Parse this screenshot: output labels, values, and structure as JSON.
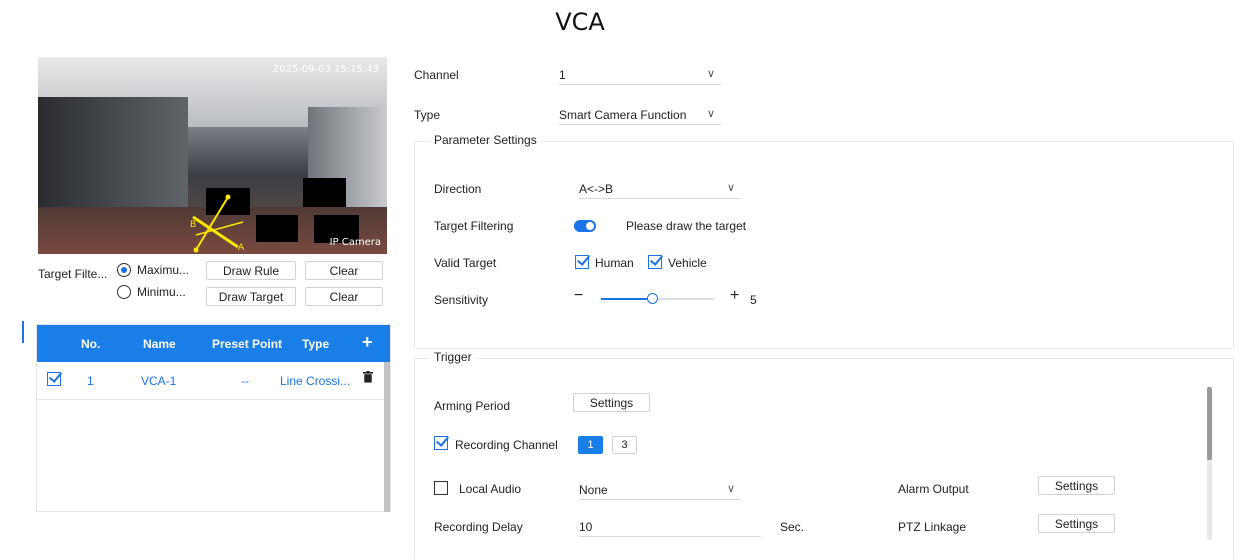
{
  "page_title": "VCA",
  "video": {
    "timestamp": "2025-09-03 15:15:43",
    "camera_name": "IP Camera"
  },
  "target_filter": {
    "label": "Target Filte...",
    "options": [
      {
        "label": "Maximu...",
        "selected": true
      },
      {
        "label": "Minimu...",
        "selected": false
      }
    ],
    "draw_rule_label": "Draw Rule",
    "draw_target_label": "Draw Target",
    "clear_label": "Clear"
  },
  "table": {
    "headers": [
      "No.",
      "Name",
      "Preset Point",
      "Type"
    ],
    "add_icon": "plus-icon",
    "rows": [
      {
        "checked": true,
        "no": "1",
        "name": "VCA-1",
        "preset": "--",
        "type": "Line Crossi..."
      }
    ]
  },
  "channel": {
    "label": "Channel",
    "value": "1"
  },
  "type": {
    "label": "Type",
    "value": "Smart Camera Function"
  },
  "parameter_settings": {
    "legend": "Parameter Settings",
    "direction_label": "Direction",
    "direction_value": "A<->B",
    "target_filtering_label": "Target Filtering",
    "target_filtering_on": true,
    "draw_hint": "Please draw the target",
    "valid_target_label": "Valid Target",
    "human_label": "Human",
    "vehicle_label": "Vehicle",
    "sensitivity_label": "Sensitivity",
    "sensitivity_value": "5",
    "sensitivity_fraction": 0.45,
    "minus": "−",
    "plus": "+"
  },
  "trigger": {
    "legend": "Trigger",
    "arming_period_label": "Arming Period",
    "settings_label": "Settings",
    "recording_channel_label": "Recording Channel",
    "recording_channels": [
      {
        "label": "1",
        "selected": true
      },
      {
        "label": "3",
        "selected": false
      }
    ],
    "local_audio_label": "Local Audio",
    "local_audio_value": "None",
    "alarm_output_label": "Alarm Output",
    "recording_delay_label": "Recording Delay",
    "recording_delay_value": "10",
    "recording_delay_unit": "Sec.",
    "ptz_linkage_label": "PTZ Linkage"
  },
  "colors": {
    "accent": "#1a7ee8"
  }
}
